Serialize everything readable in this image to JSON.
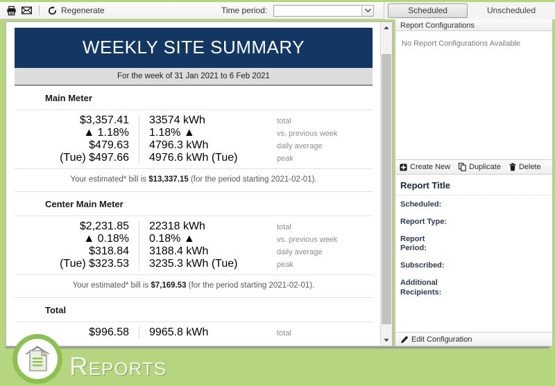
{
  "toolbar": {
    "print_icon": "printer-icon",
    "mail_icon": "envelope-icon",
    "regenerate_label": "Regenerate",
    "regenerate_icon": "refresh-icon",
    "time_period_label": "Time period:",
    "time_period_value": "",
    "time_period_placeholder": "",
    "dropdown_icon": "chevron-down-icon"
  },
  "tabs": [
    {
      "label": "Scheduled",
      "active": true
    },
    {
      "label": "Unscheduled",
      "active": false
    }
  ],
  "report": {
    "title": "WEEKLY SITE SUMMARY",
    "subtitle": "For the week of 31 Jan 2021 to 6 Feb 2021",
    "row_labels": {
      "total": "total",
      "change": "vs. previous week",
      "average": "daily average",
      "peak": "peak"
    },
    "sections": [
      {
        "name": "Main Meter",
        "total_cost": "$3,357.41",
        "total_energy": "33574 kWh",
        "change_cost": "▲ 1.18%",
        "change_energy": "1.18% ▲",
        "avg_cost": "$479.63",
        "avg_energy": "4796.3 kWh",
        "peak_cost": "(Tue) $497.66",
        "peak_energy": "4976.6 kWh (Tue)",
        "bill_prefix": "Your estimated* bill is ",
        "bill_amount": "$13,337.15",
        "bill_suffix": " (for the period starting 2021-02-01)."
      },
      {
        "name": "Center Main Meter",
        "total_cost": "$2,231.85",
        "total_energy": "22318 kWh",
        "change_cost": "▲ 0.18%",
        "change_energy": "0.18% ▲",
        "avg_cost": "$318.84",
        "avg_energy": "3188.4 kWh",
        "peak_cost": "(Tue) $323.53",
        "peak_energy": "3235.3 kWh (Tue)",
        "bill_prefix": "Your estimated* bill is ",
        "bill_amount": "$7,169.53",
        "bill_suffix": " (for the period starting 2021-02-01)."
      },
      {
        "name": "Total",
        "total_cost": "$996.58",
        "total_energy": "9965.8 kWh",
        "change_cost": "",
        "change_energy": "",
        "avg_cost": "",
        "avg_energy": "",
        "peak_cost": "",
        "peak_energy": "",
        "bill_prefix": "",
        "bill_amount": "",
        "bill_suffix": ""
      }
    ]
  },
  "right_panel": {
    "header": "Report Configurations",
    "empty_message": "No Report Configurations Available",
    "actions": [
      {
        "label": "Create New",
        "icon": "plus-square-icon"
      },
      {
        "label": "Duplicate",
        "icon": "copy-pages-icon"
      },
      {
        "label": "Delete",
        "icon": "trash-icon"
      }
    ],
    "details_title": "Report Title",
    "fields": [
      {
        "label": "Scheduled:",
        "value": ""
      },
      {
        "label": "Report Type:",
        "value": ""
      },
      {
        "label": "Report Period:",
        "value": ""
      },
      {
        "label": "Subscribed:",
        "value": ""
      },
      {
        "label": "Additional Recipients:",
        "value": ""
      }
    ],
    "footer_action": {
      "label": "Edit Configuration",
      "icon": "pencil-icon"
    }
  },
  "branding": {
    "title": "Reports",
    "logo_icon": "document-house-icon"
  },
  "colors": {
    "app_green": "#b5d57f",
    "logo_green": "#8cc152",
    "report_header_navy": "#123763",
    "increase_red": "#ed1c24"
  }
}
